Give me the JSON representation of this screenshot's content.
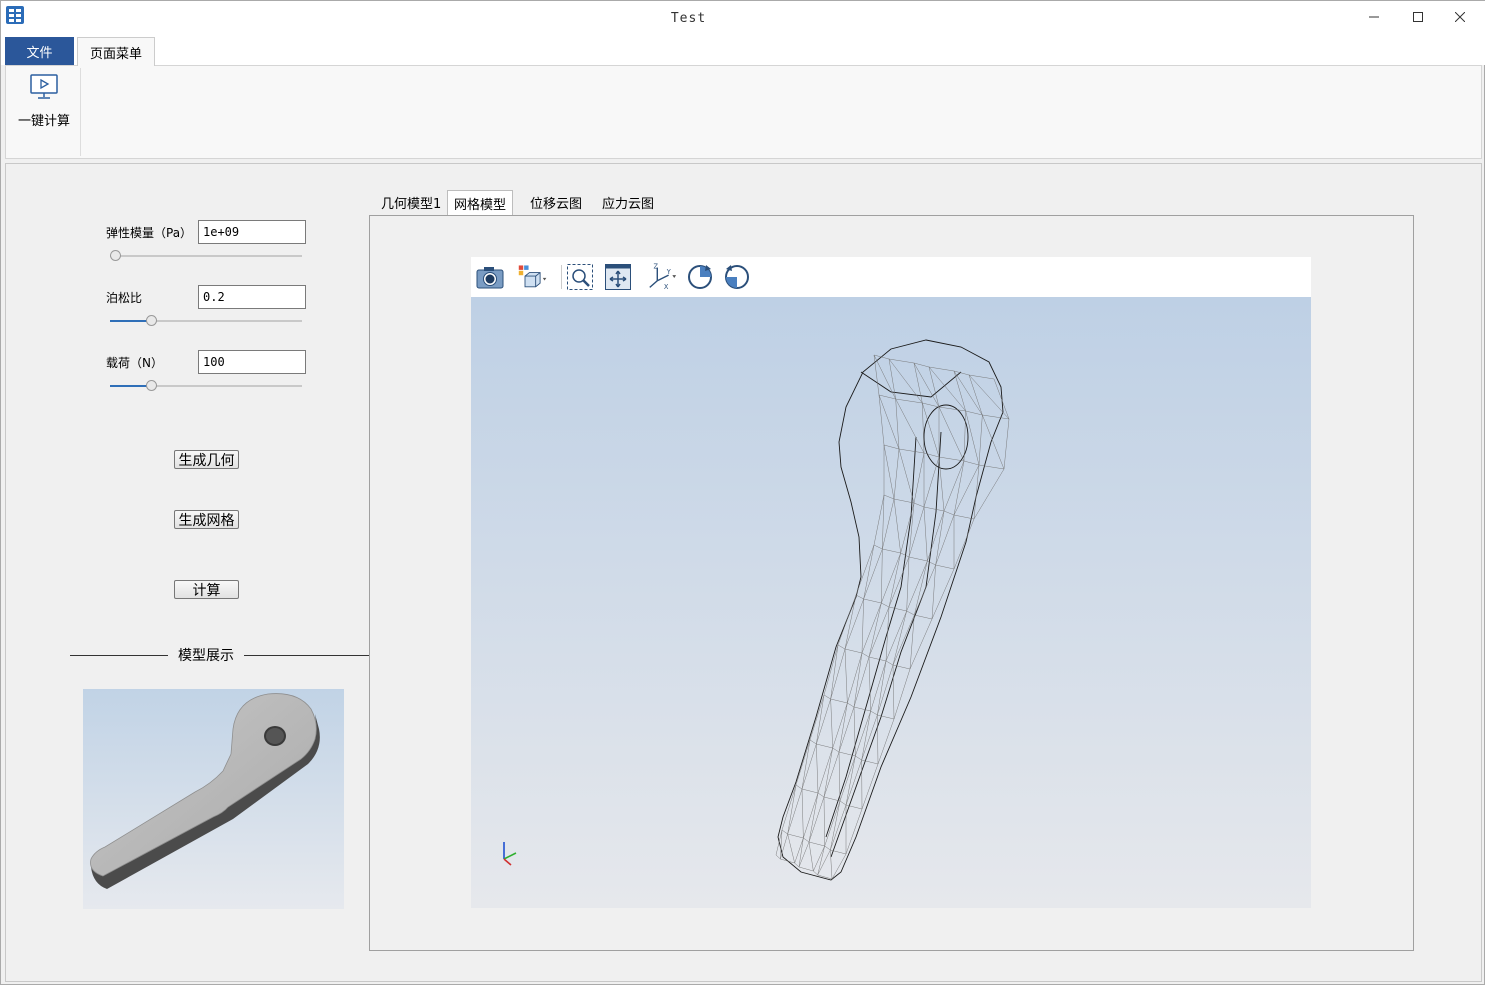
{
  "window": {
    "title": "Test"
  },
  "ribbon": {
    "tabs": [
      {
        "label": "文件"
      },
      {
        "label": "页面菜单"
      }
    ],
    "buttons": [
      {
        "label": "一键计算",
        "icon": "monitor-play-icon"
      }
    ]
  },
  "params": {
    "elastic_modulus": {
      "label": "弹性模量（Pa）",
      "value": "1e+09",
      "slider_fraction": 0.0
    },
    "poisson_ratio": {
      "label": "泊松比",
      "value": "0.2",
      "slider_fraction": 0.2
    },
    "load": {
      "label": "载荷（N）",
      "value": "100",
      "slider_fraction": 0.2
    }
  },
  "actions": {
    "generate_geometry": "生成几何",
    "generate_mesh": "生成网格",
    "compute": "计算"
  },
  "preview": {
    "title": "模型展示"
  },
  "view_tabs": [
    {
      "label": "几何模型1",
      "active": false
    },
    {
      "label": "网格模型",
      "active": true
    },
    {
      "label": "位移云图",
      "active": false
    },
    {
      "label": "应力云图",
      "active": false
    }
  ],
  "viewer_toolbar": [
    {
      "icon": "camera-icon"
    },
    {
      "icon": "view-cube-dropdown-icon"
    },
    {
      "icon": "zoom-window-icon"
    },
    {
      "icon": "fit-all-icon"
    },
    {
      "icon": "axes-dropdown-icon"
    },
    {
      "icon": "rotate-cw-icon"
    },
    {
      "icon": "rotate-ccw-icon"
    }
  ],
  "colors": {
    "accent": "#2b579a",
    "viewport_top": "#bed0e5",
    "viewport_bottom": "#e6e8ec"
  }
}
